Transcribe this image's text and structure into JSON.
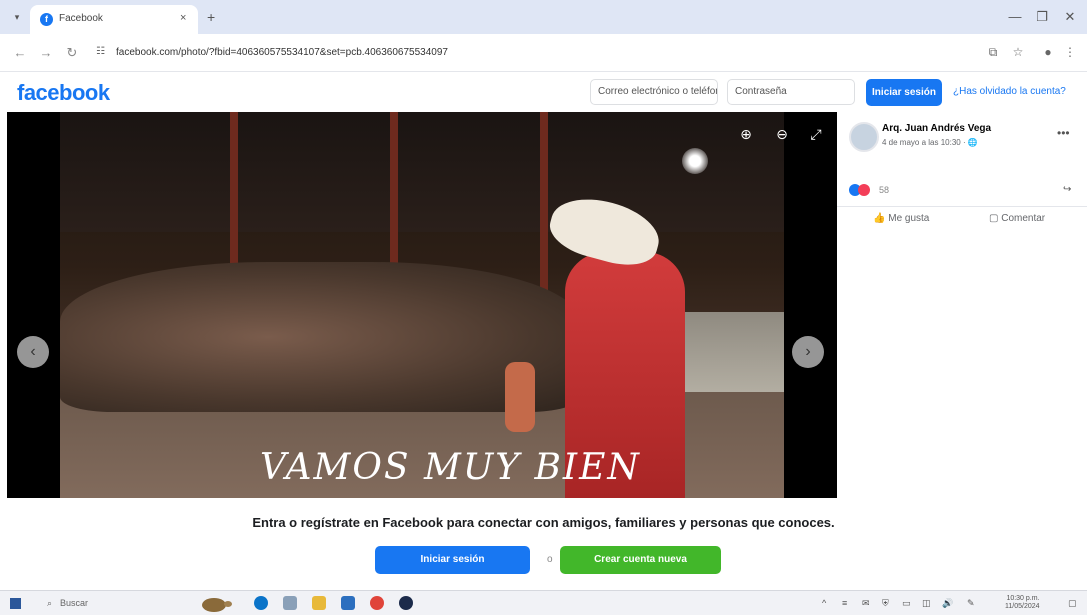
{
  "browser": {
    "tab_title": "Facebook",
    "tab_close": "×",
    "new_tab": "+",
    "url_site_info": "☷",
    "url": "facebook.com/photo/?fbid=406360575534107&set=pcb.406360675534097",
    "window_buttons": [
      "—",
      "❐",
      "✕"
    ]
  },
  "header": {
    "logo": "facebook",
    "email_placeholder": "Correo electrónico o teléfono",
    "password_placeholder": "Contraseña",
    "login_label": "Iniciar sesión",
    "forgot_label": "¿Has olvidado la cuenta?"
  },
  "photo": {
    "caption": "VAMOS MUY  BIEN",
    "prev_label": "‹",
    "next_label": "›"
  },
  "post": {
    "author": "Arq. Juan Andrés Vega",
    "date": "4 de mayo a las 10:30 · 🌐",
    "reaction_count": "58",
    "like_label": "Me gusta",
    "comment_label": "Comentar"
  },
  "prompt": {
    "text": "Entra o regístrate en Facebook para conectar con amigos, familiares y personas que conoces.",
    "login_label": "Iniciar sesión",
    "separator": "o",
    "create_label": "Crear cuenta nueva"
  },
  "taskbar": {
    "search_label": "Buscar",
    "clock_time": "10:30 p.m.",
    "clock_date": "11/05/2024"
  },
  "colors": {
    "brand": "#1877f2",
    "create": "#42b72a"
  }
}
